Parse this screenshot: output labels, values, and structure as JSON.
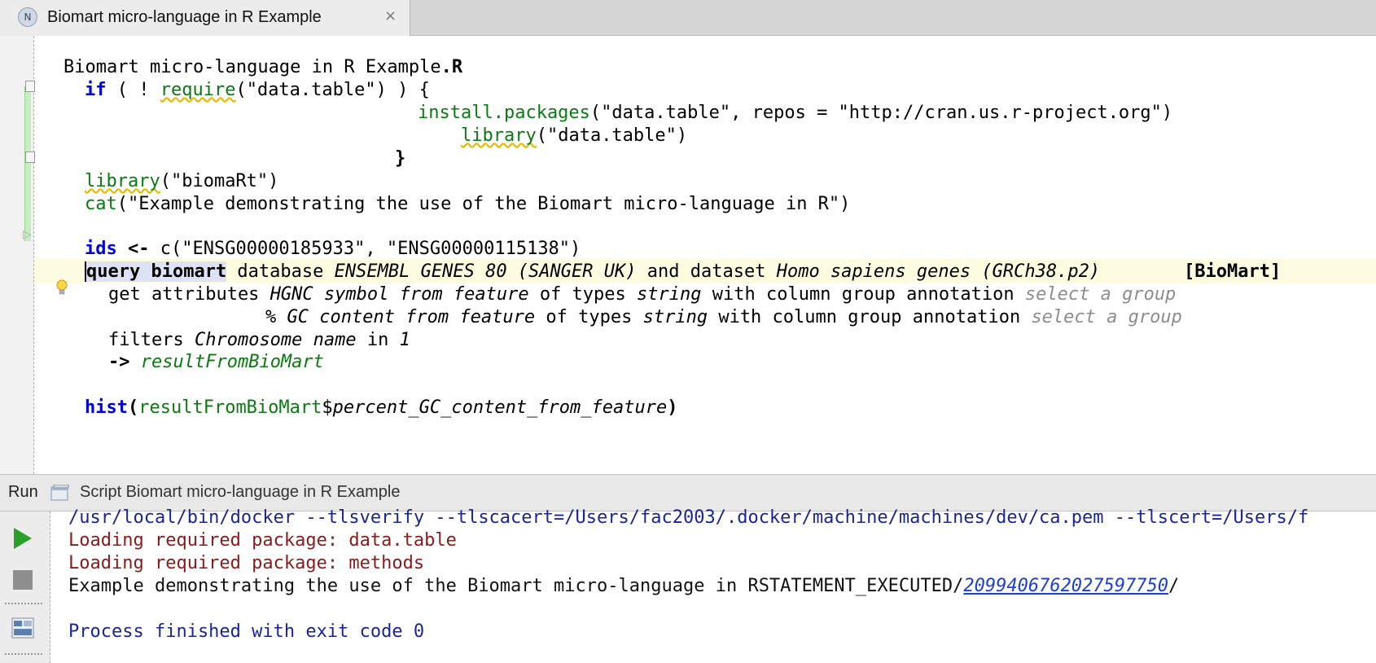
{
  "tab": {
    "badge": "N",
    "title": "Biomart micro-language in R Example",
    "close": "×"
  },
  "editor": {
    "file_title_plain": "Biomart micro-language in R Example",
    "file_title_ext": ".R",
    "if_kw": "if",
    "paren_open": " ( ! ",
    "require_fn": "require",
    "require_arg": "(\"data.table\") ) {",
    "install_fn": "install.packages",
    "install_args": "(\"data.table\", repos = \"http://cran.us.r-project.org\")",
    "library_fn": "library",
    "library_dt_arg": "(\"data.table\")",
    "close_brace": "}",
    "library_biomart_arg": "(\"biomaRt\")",
    "cat_fn": "cat",
    "cat_arg": "(\"Example demonstrating the use of the Biomart micro-language in R\")",
    "ids_kw": "ids",
    "assign": " <- ",
    "ids_value": "c(\"ENSG00000185933\", \"ENSG00000115138\")",
    "query_kw": "query biomart",
    "database_word": " database ",
    "database_name": "ENSEMBL GENES 80 (SANGER UK)",
    "and_dataset": " and dataset ",
    "dataset_name": "Homo sapiens genes (GRCh38.p2)",
    "biomart_tag": "[BioMart]",
    "get_attributes": "get attributes ",
    "attr1": "HGNC symbol from feature",
    "of_types": " of types ",
    "string_type": "string",
    "with_group": " with column group annotation ",
    "select_group": "select a group",
    "attr2": "% GC content from feature",
    "filters_word": "filters ",
    "filter_name": "Chromosome name",
    "in_word": " in ",
    "filter_value": "1",
    "arrow": "->",
    "result_var": "resultFromBioMart",
    "hist_fn": "hist",
    "hist_open": "(",
    "hist_dollar": "$",
    "hist_field": "percent_GC_content_from_feature",
    "hist_close": ")"
  },
  "runbar": {
    "label": "Run",
    "title": "Script Biomart micro-language in R Example"
  },
  "console": {
    "line1": "/usr/local/bin/docker --tlsverify --tlscacert=/Users/fac2003/.docker/machine/machines/dev/ca.pem --tlscert=/Users/f",
    "line2": "Loading required package: data.table",
    "line3": "Loading required package: methods",
    "line4_text": "Example demonstrating the use of the Biomart micro-language in RSTATEMENT_EXECUTED/",
    "line4_link": "2099406762027597750",
    "line4_tail": "/",
    "line5": "Process finished with exit code 0"
  }
}
